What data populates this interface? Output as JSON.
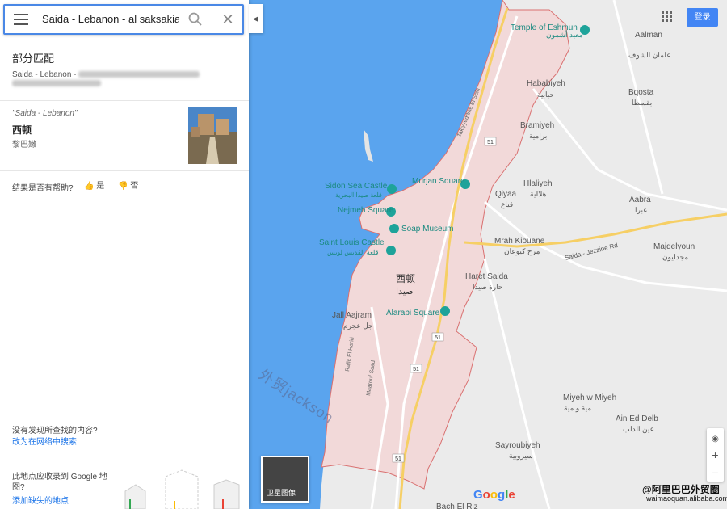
{
  "search": {
    "value": "Saida - Lebanon - al saksakia - al"
  },
  "sidebar": {
    "section_title": "部分匹配",
    "partial_match_text": "Saida - Lebanon -",
    "result": {
      "quote": "\"Saida - Lebanon\"",
      "name": "西顿",
      "country": "黎巴嫩"
    },
    "helpful_question": "结果是否有帮助?",
    "yes_label": "是",
    "no_label": "否",
    "not_found_text": "没有发现所查找的内容?",
    "web_search_link": "改为在网络中搜索",
    "missing_place_text": "此地点应收录到 Google 地图?",
    "add_place_link": "添加缺失的地点"
  },
  "header": {
    "signin_label": "登录",
    "apps_icon": "apps-grid-icon"
  },
  "satellite_label": "卫星图像",
  "google_logo": "Google",
  "controls": {
    "zoom_in": "+",
    "zoom_out": "−"
  },
  "watermarks": {
    "site": "@阿里巴巴外贸圈",
    "url": "waimaoquan.alibaba.com",
    "diagonal": "外贸jackson"
  },
  "map_labels": {
    "temple": "Temple of Eshmun",
    "temple_ar": "معبد أشمون",
    "aalman": "Aalman",
    "aalman_ar": "علمان الشوف",
    "hababiyeh": "Hababiyeh",
    "hababiyeh_ar": "حبابية",
    "bqosta": "Bqosta",
    "bqosta_ar": "بقسطا",
    "bramiyeh": "Bramiyeh",
    "bramiyeh_ar": "برامية",
    "hlaliyeh": "Hlaliyeh",
    "hlaliyeh_ar": "هلالية",
    "qiyaa": "Qiyaa",
    "qiyaa_ar": "قياع",
    "aabra": "Aabra",
    "aabra_ar": "عبرا",
    "sidon_sea_castle": "Sidon Sea Castle",
    "sidon_sea_castle_ar": "قلعة صيدا البحرية",
    "murjan_square": "Murjan Square",
    "nejmeh_square": "Nejmeh Square",
    "soap_museum": "Soap Museum",
    "saint_louis": "Saint Louis Castle",
    "saint_louis_ar": "قلعة القديس لويس",
    "mrah_kiouane": "Mrah Kiouane",
    "mrah_kiouane_ar": "مرح كيوعان",
    "majdelyoun": "Majdelyoun",
    "majdelyoun_ar": "مجدليون",
    "saida_jezzine_rd": "Saida - Jezzine Rd",
    "city_zh": "西顿",
    "city_ar": "صيدا",
    "haret_saida": "Haret Saida",
    "haret_saida_ar": "حارة صيدا",
    "jall_aajram": "Jall Aajram",
    "jall_aajram_ar": "جل عجرم",
    "alarabi_square": "Alarabi Square",
    "miyeh": "Miyeh w Miyeh",
    "miyeh_ar": "مية و مية",
    "ain_ed_delb": "Ain Ed Delb",
    "ain_ed_delb_ar": "عين الدلب",
    "sayroubiyeh": "Sayroubiyeh",
    "sayroubiyeh_ar": "سيروبية",
    "rafic_el_hariri": "Rafic El Hariri",
    "maarouf_saad": "Maarouf Saad",
    "takiyyeddine": "Takiyyeddine El Solh",
    "rd51": "51",
    "bach_el_riz": "Bach El Riz"
  }
}
